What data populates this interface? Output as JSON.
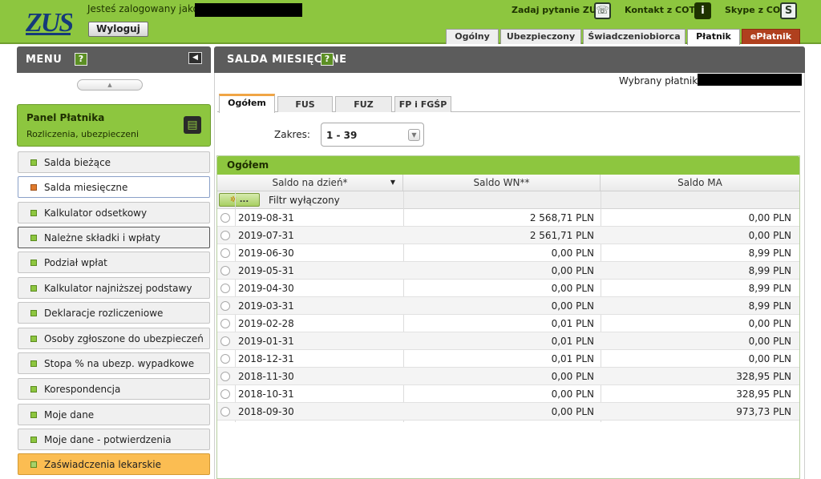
{
  "header": {
    "logo_text": "ZUS",
    "logged_in_label": "Jesteś zalogowany jako:",
    "logout_label": "Wyloguj",
    "links": {
      "ask": "Zadaj pytanie ZUS",
      "contact": "Kontakt z COT",
      "skype": "Skype z COT"
    },
    "tabs": [
      "Ogólny",
      "Ubezpieczony",
      "Świadczeniobiorca",
      "Płatnik",
      "ePłatnik"
    ],
    "active_tab": "Płatnik"
  },
  "menu": {
    "title": "MENU",
    "panel": {
      "title": "Panel Płatnika",
      "subtitle": "Rozliczenia, ubezpieczeni"
    },
    "items": [
      "Salda bieżące",
      "Salda miesięczne",
      "Kalkulator odsetkowy",
      "Należne składki i wpłaty",
      "Podział wpłat",
      "Kalkulator najniższej podstawy",
      "Deklaracje rozliczeniowe",
      "Osoby zgłoszone do ubezpieczeń",
      "Stopa % na ubezp. wypadkowe",
      "Korespondencja",
      "Moje dane",
      "Moje dane - potwierdzenia",
      "Zaświadczenia lekarskie"
    ],
    "active_item": "Salda miesięczne"
  },
  "main": {
    "title": "SALDA MIESIĘCZNE",
    "payer_label": "Wybrany płatnik:",
    "subtabs": [
      "Ogółem",
      "FUS",
      "FUZ",
      "FP i FGŚP"
    ],
    "active_subtab": "Ogółem",
    "range_label": "Zakres:",
    "range_value": "1 - 39",
    "grid": {
      "title": "Ogółem",
      "columns": [
        "Saldo na dzień*",
        "Saldo WN**",
        "Saldo MA"
      ],
      "filter_button": "...",
      "filter_text": "Filtr wyłączony",
      "rows": [
        {
          "date": "2019-08-31",
          "wn": "2 568,71 PLN",
          "ma": "0,00 PLN"
        },
        {
          "date": "2019-07-31",
          "wn": "2 561,71 PLN",
          "ma": "0,00 PLN"
        },
        {
          "date": "2019-06-30",
          "wn": "0,00 PLN",
          "ma": "8,99 PLN"
        },
        {
          "date": "2019-05-31",
          "wn": "0,00 PLN",
          "ma": "8,99 PLN"
        },
        {
          "date": "2019-04-30",
          "wn": "0,00 PLN",
          "ma": "8,99 PLN"
        },
        {
          "date": "2019-03-31",
          "wn": "0,00 PLN",
          "ma": "8,99 PLN"
        },
        {
          "date": "2019-02-28",
          "wn": "0,01 PLN",
          "ma": "0,00 PLN"
        },
        {
          "date": "2019-01-31",
          "wn": "0,01 PLN",
          "ma": "0,00 PLN"
        },
        {
          "date": "2018-12-31",
          "wn": "0,01 PLN",
          "ma": "0,00 PLN"
        },
        {
          "date": "2018-11-30",
          "wn": "0,00 PLN",
          "ma": "328,95 PLN"
        },
        {
          "date": "2018-10-31",
          "wn": "0,00 PLN",
          "ma": "328,95 PLN"
        },
        {
          "date": "2018-09-30",
          "wn": "0,00 PLN",
          "ma": "973,73 PLN"
        }
      ]
    }
  },
  "colors": {
    "brand_green": "#8dc63f",
    "header_dark": "#5c5c5c",
    "eplatnik_red": "#b0401e",
    "highlight_orange": "#fbbd52"
  }
}
